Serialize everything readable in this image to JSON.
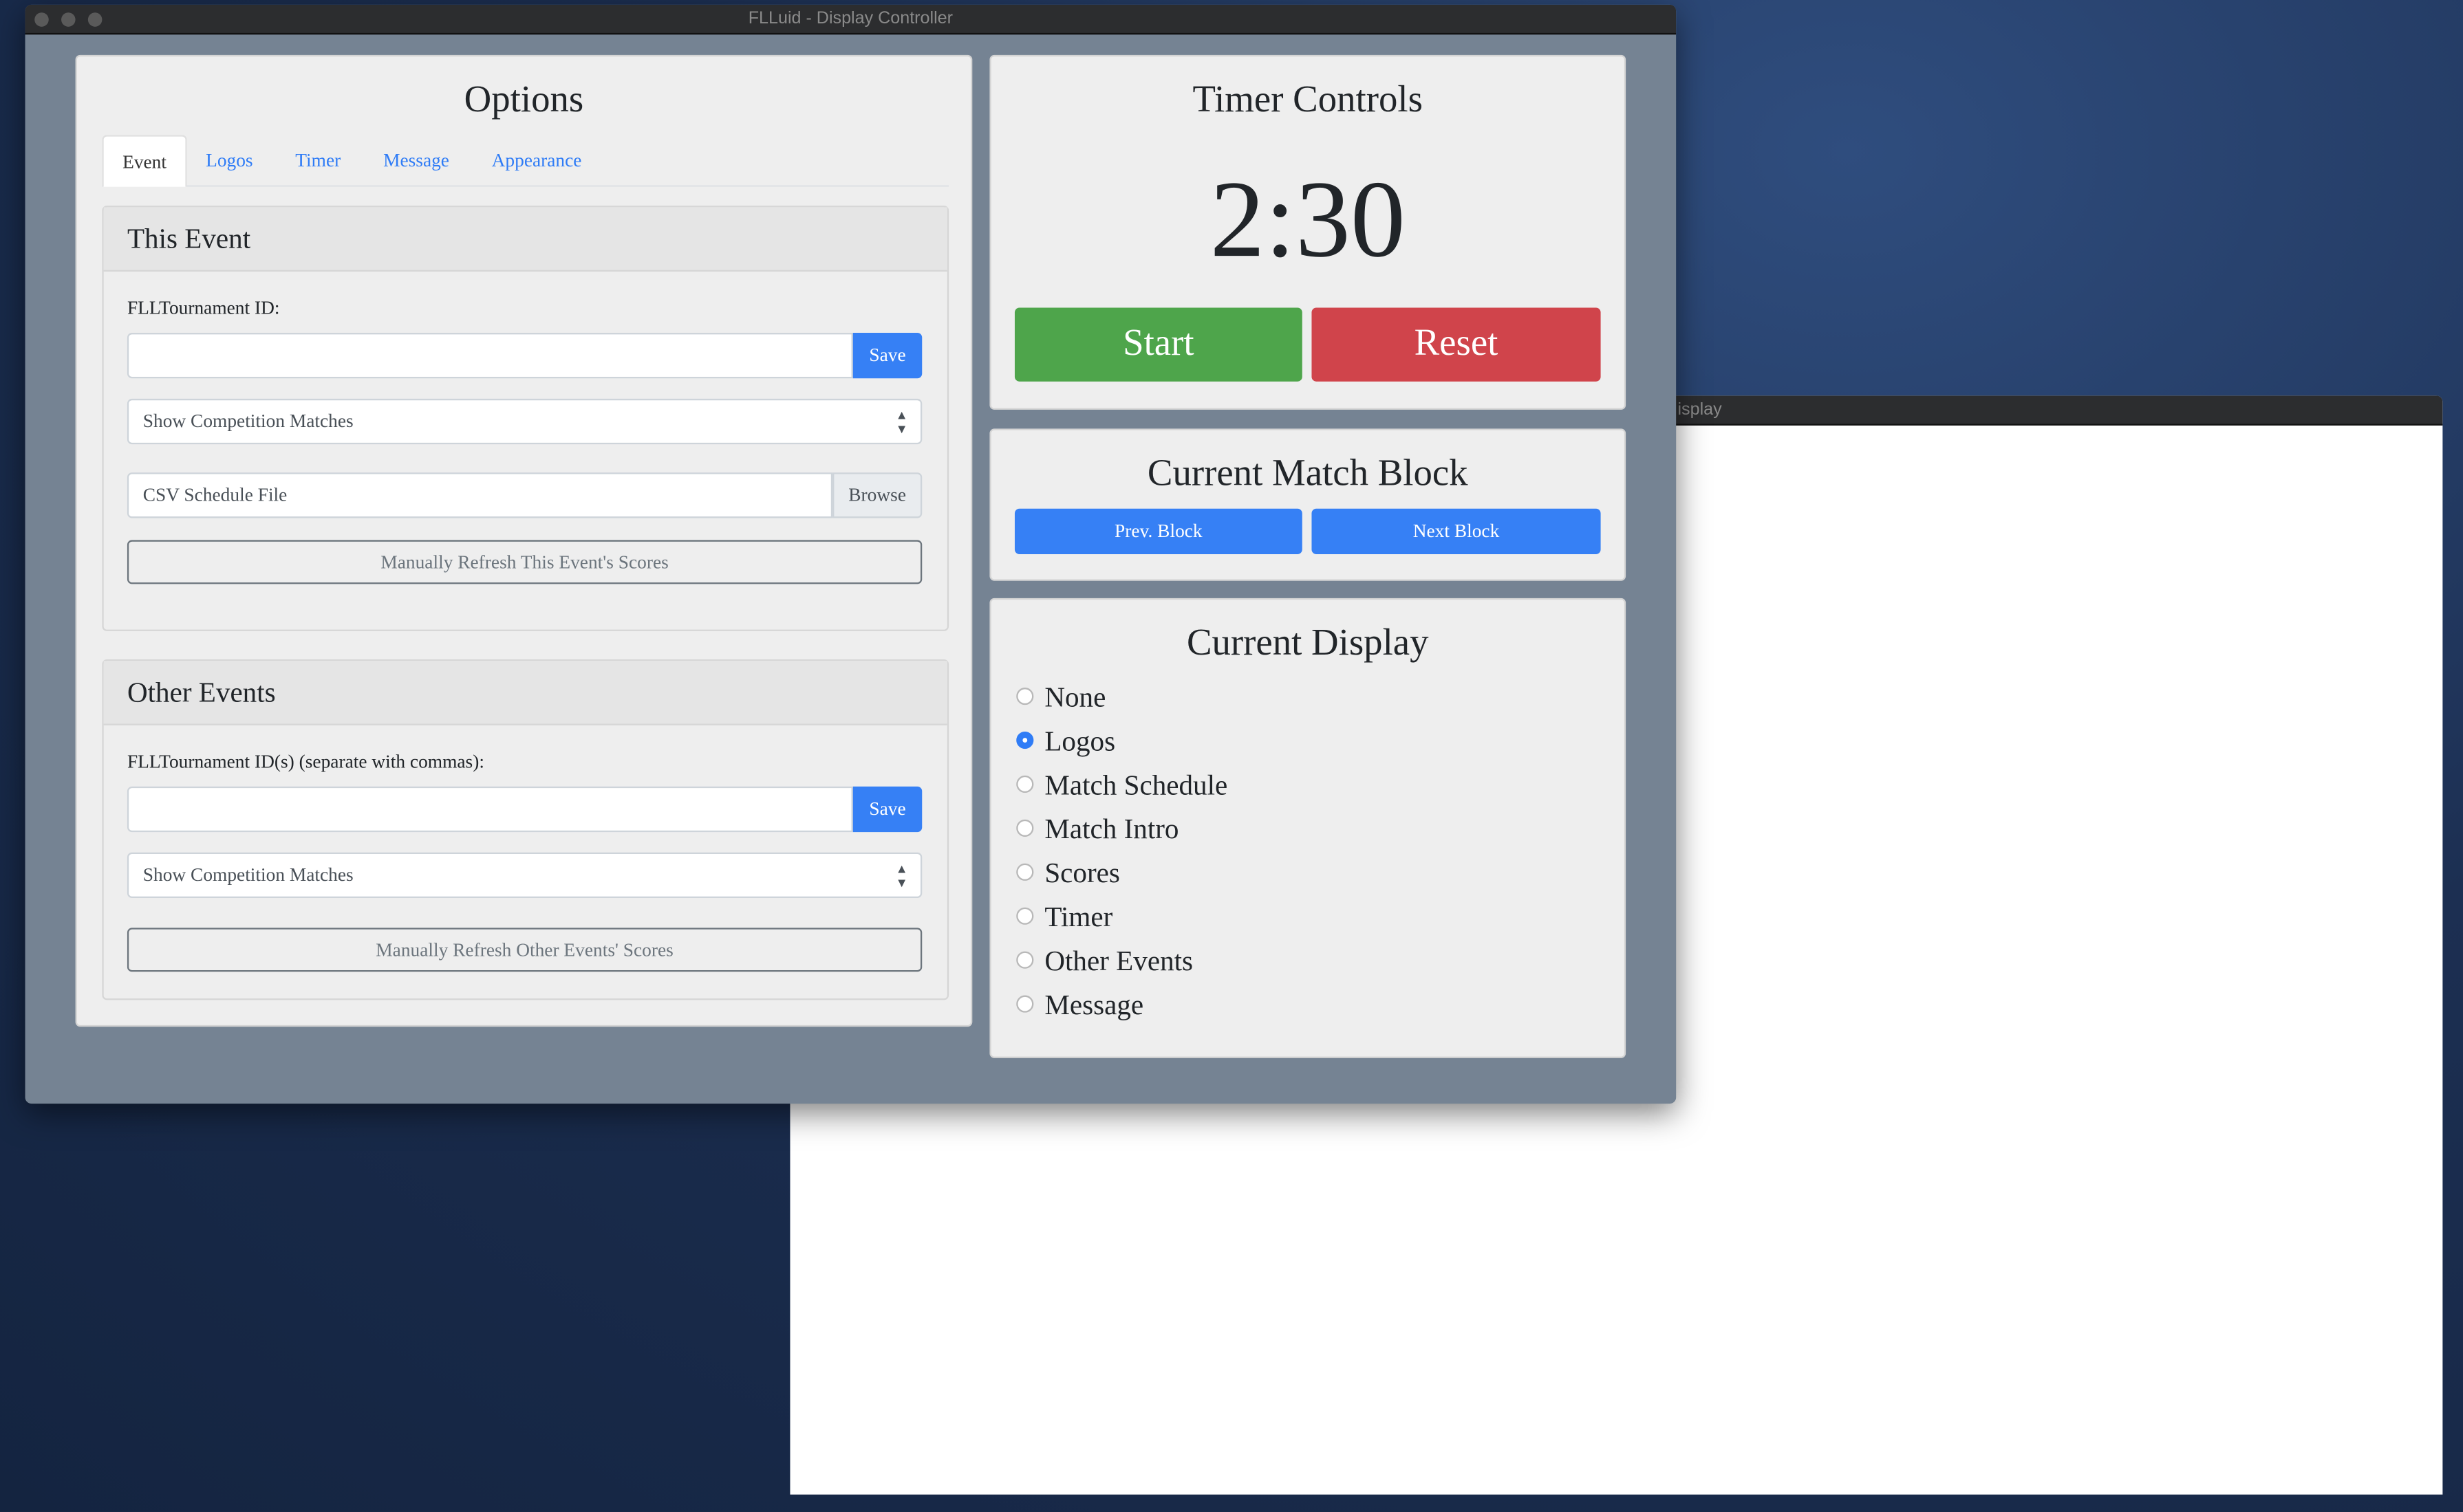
{
  "main_window": {
    "title": "FLLuid - Display Controller"
  },
  "display_window": {
    "title_partial": "isplay"
  },
  "options": {
    "title": "Options",
    "tabs": [
      {
        "label": "Event",
        "active": true
      },
      {
        "label": "Logos"
      },
      {
        "label": "Timer"
      },
      {
        "label": "Message"
      },
      {
        "label": "Appearance"
      }
    ],
    "this_event": {
      "heading": "This Event",
      "id_label": "FLLTournament ID:",
      "id_value": "",
      "save": "Save",
      "select_value": "Show Competition Matches",
      "file_placeholder": "CSV Schedule File",
      "browse": "Browse",
      "refresh": "Manually Refresh This Event's Scores"
    },
    "other_events": {
      "heading": "Other Events",
      "id_label": "FLLTournament ID(s) (separate with commas):",
      "id_value": "",
      "save": "Save",
      "select_value": "Show Competition Matches",
      "refresh": "Manually Refresh Other Events' Scores"
    }
  },
  "timer": {
    "title": "Timer Controls",
    "time": "2:30",
    "start": "Start",
    "reset": "Reset"
  },
  "match_block": {
    "title": "Current Match Block",
    "prev": "Prev. Block",
    "next": "Next Block"
  },
  "display": {
    "title": "Current Display",
    "options": [
      "None",
      "Logos",
      "Match Schedule",
      "Match Intro",
      "Scores",
      "Timer",
      "Other Events",
      "Message"
    ],
    "selected": "Logos"
  },
  "colors": {
    "start": "#4ea54b",
    "reset": "#d0444b",
    "primary": "#3680f5",
    "window_bg": "#758393"
  }
}
